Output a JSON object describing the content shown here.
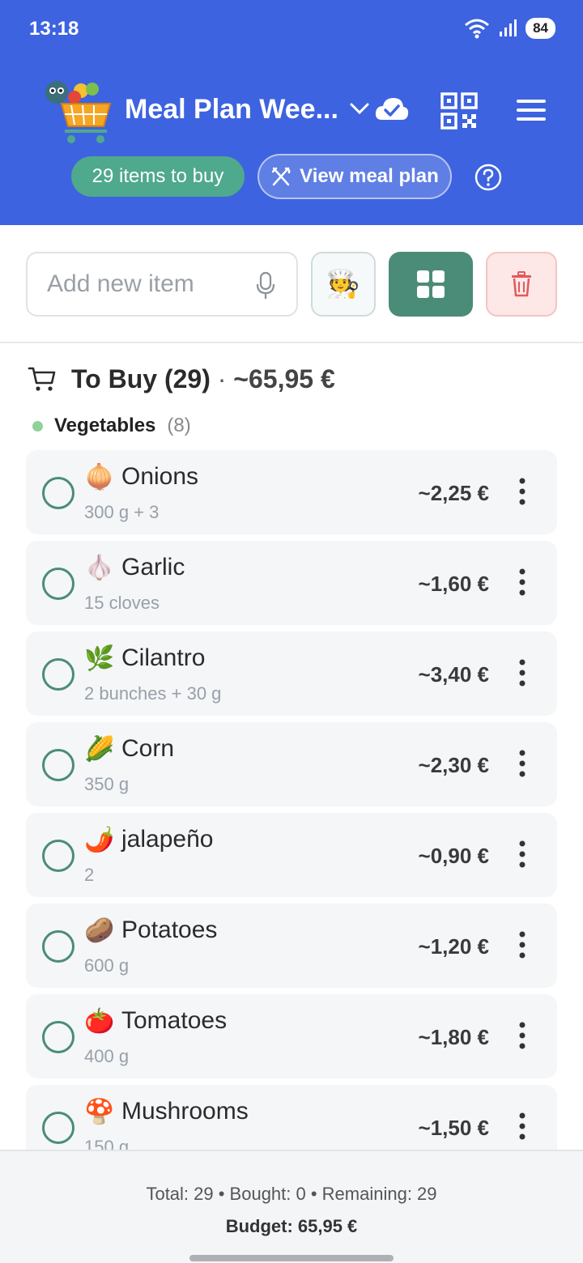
{
  "status_bar": {
    "time": "13:18",
    "battery": "84"
  },
  "header": {
    "title": "Meal Plan Wee...",
    "items_badge": "29 items to buy",
    "view_meal_plan": "View meal plan"
  },
  "toolbar": {
    "add_placeholder": "Add new item"
  },
  "section": {
    "title": "To Buy (29)",
    "separator": "·",
    "total": "~65,95 €"
  },
  "category": {
    "name": "Vegetables",
    "count": "(8)",
    "color": "#8fd29a"
  },
  "items": [
    {
      "emoji": "🧅",
      "name": "Onions",
      "qty": "300 g + 3",
      "price": "~2,25 €"
    },
    {
      "emoji": "🧄",
      "name": "Garlic",
      "qty": "15 cloves",
      "price": "~1,60 €"
    },
    {
      "emoji": "🌿",
      "name": "Cilantro",
      "qty": "2 bunches + 30 g",
      "price": "~3,40 €"
    },
    {
      "emoji": "🌽",
      "name": "Corn",
      "qty": "350 g",
      "price": "~2,30 €"
    },
    {
      "emoji": "🌶️",
      "name": "jalapeño",
      "qty": "2",
      "price": "~0,90 €"
    },
    {
      "emoji": "🥔",
      "name": "Potatoes",
      "qty": "600 g",
      "price": "~1,20 €"
    },
    {
      "emoji": "🍅",
      "name": "Tomatoes",
      "qty": "400 g",
      "price": "~1,80 €"
    },
    {
      "emoji": "🍄",
      "name": "Mushrooms",
      "qty": "150 g",
      "price": "~1,50 €"
    }
  ],
  "footer": {
    "stats": "Total: 29 • Bought: 0 • Remaining: 29",
    "budget": "Budget: 65,95 €"
  },
  "colors": {
    "header_bg": "#3d63e0",
    "accent_green": "#4a8c78",
    "badge_green": "#4fa98c"
  }
}
